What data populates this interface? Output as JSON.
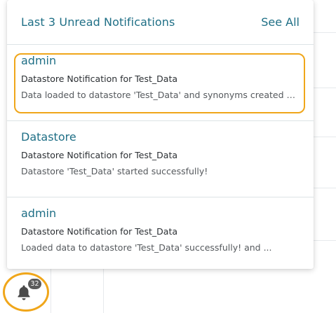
{
  "notifications_panel": {
    "title": "Last 3 Unread Notifications",
    "see_all_label": "See All",
    "items": [
      {
        "sender": "admin",
        "title": "Datastore Notification for Test_Data",
        "description": "Data loaded to datastore 'Test_Data' and synonyms created successfully!"
      },
      {
        "sender": "Datastore",
        "title": "Datastore Notification for Test_Data",
        "description": "Datastore 'Test_Data' started successfully!"
      },
      {
        "sender": "admin",
        "title": "Datastore Notification for Test_Data",
        "description": "Loaded data to datastore 'Test_Data' successfully! and ..."
      }
    ]
  },
  "notification_bell": {
    "icon": "bell-icon",
    "unread_count": "32"
  },
  "colors": {
    "accent": "#1f6f86",
    "highlight": "#f0a61a",
    "badge": "#5a5a5a"
  }
}
